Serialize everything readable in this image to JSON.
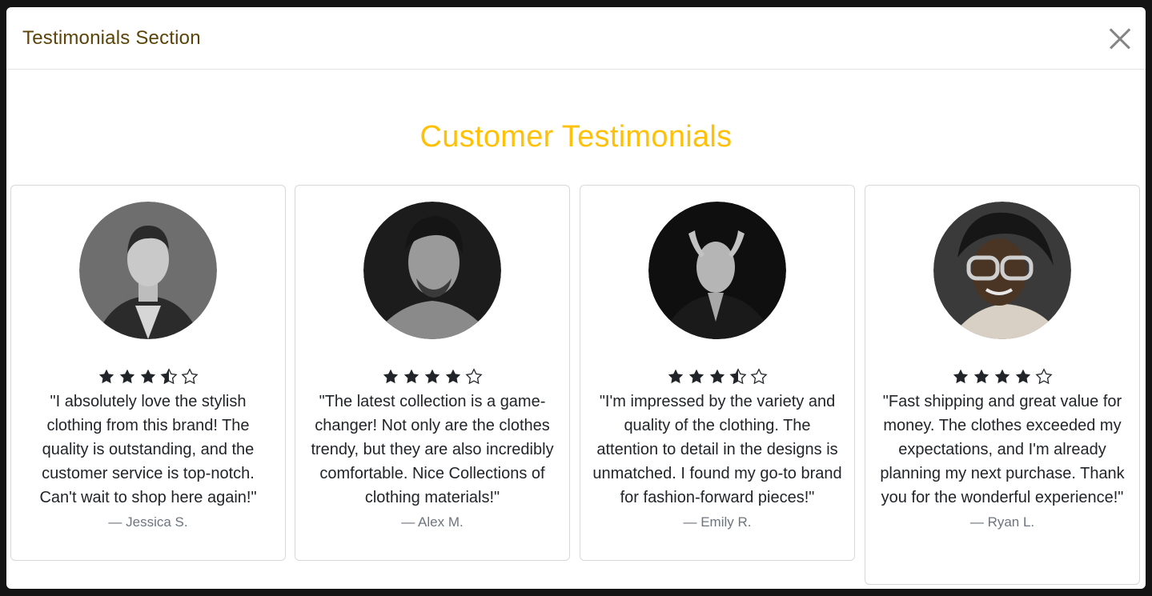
{
  "modal": {
    "title": "Testimonials Section"
  },
  "heading": "Customer Testimonials",
  "colors": {
    "accent": "#ffc107",
    "title": "#5c4308",
    "star": "#212529"
  },
  "testimonials": [
    {
      "rating": 3.5,
      "quote": "\"I absolutely love the stylish clothing from this brand! The quality is outstanding, and the customer service is top-notch. Can't wait to shop here again!\"",
      "author": "— Jessica S."
    },
    {
      "rating": 4,
      "quote": "\"The latest collection is a game-changer! Not only are the clothes trendy, but they are also incredibly comfortable. Nice Collections of clothing materials!\"",
      "author": "— Alex M."
    },
    {
      "rating": 3.5,
      "quote": "\"I'm impressed by the variety and quality of the clothing. The attention to detail in the designs is unmatched. I found my go-to brand for fashion-forward pieces!\"",
      "author": "— Emily R."
    },
    {
      "rating": 4,
      "quote": "\"Fast shipping and great value for money. The clothes exceeded my expectations, and I'm already planning my next purchase. Thank you for the wonderful experience!\"",
      "author": "— Ryan L."
    }
  ]
}
